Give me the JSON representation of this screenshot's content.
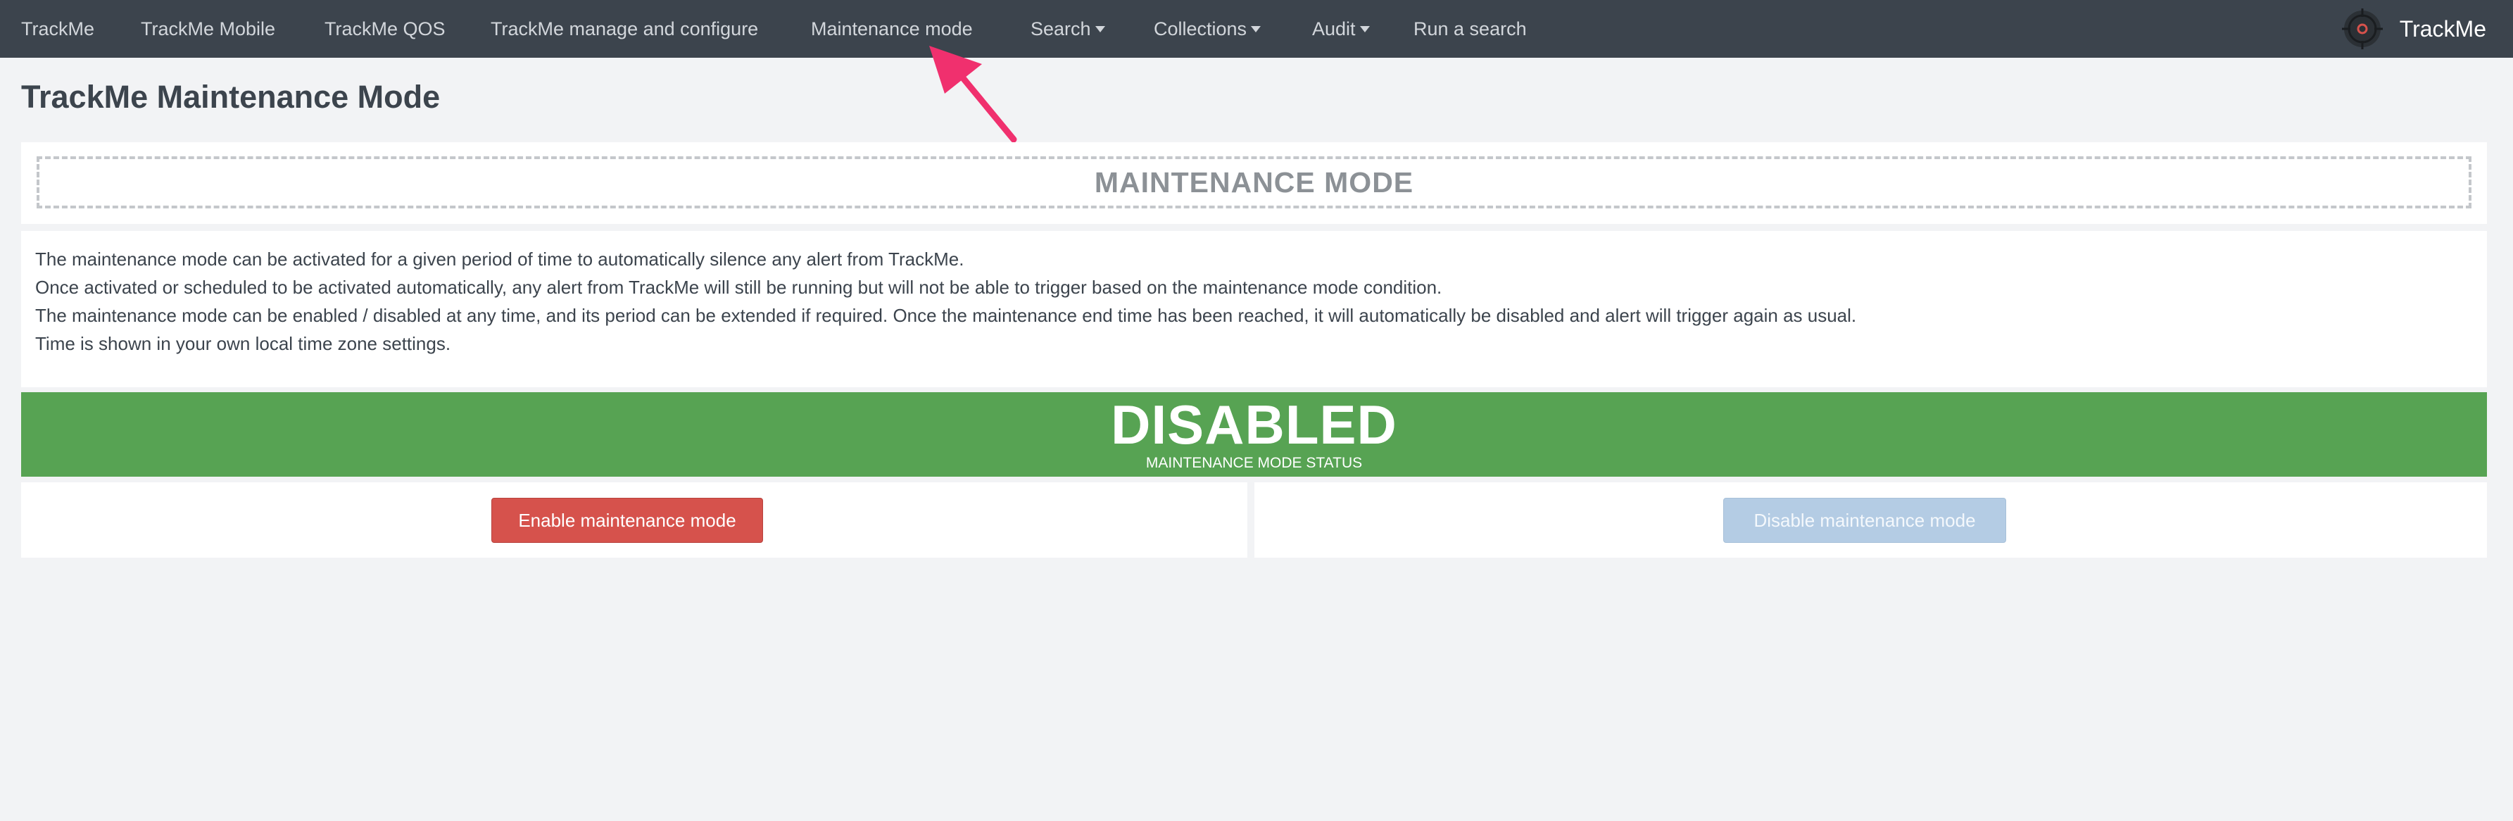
{
  "nav": {
    "items": [
      {
        "label": "TrackMe"
      },
      {
        "label": "TrackMe Mobile"
      },
      {
        "label": "TrackMe QOS"
      },
      {
        "label": "TrackMe manage and configure"
      },
      {
        "label": "Maintenance mode"
      },
      {
        "label": "Search"
      },
      {
        "label": "Collections"
      },
      {
        "label": "Audit"
      },
      {
        "label": "Run a search"
      }
    ],
    "brand": "TrackMe",
    "brand_icon": "target-icon"
  },
  "page": {
    "title": "TrackMe Maintenance Mode",
    "banner": "MAINTENANCE MODE",
    "description": [
      "The maintenance mode can be activated for a given period of time to automatically silence any alert from TrackMe.",
      "Once activated or scheduled to be activated automatically, any alert from TrackMe will still be running but will not be able to trigger based on the maintenance mode condition.",
      "The maintenance mode can be enabled / disabled at any time, and its period can be extended if required. Once the maintenance end time has been reached, it will automatically be disabled and alert will trigger again as usual.",
      "Time is shown in your own local time zone settings."
    ]
  },
  "status": {
    "value": "DISABLED",
    "label": "MAINTENANCE MODE STATUS",
    "color": "#57a353"
  },
  "actions": {
    "enable_label": "Enable maintenance mode",
    "disable_label": "Disable maintenance mode",
    "enable_color": "#d6524c",
    "disable_color": "#b4cce4"
  },
  "annotation": {
    "arrow_color": "#f0306e"
  }
}
